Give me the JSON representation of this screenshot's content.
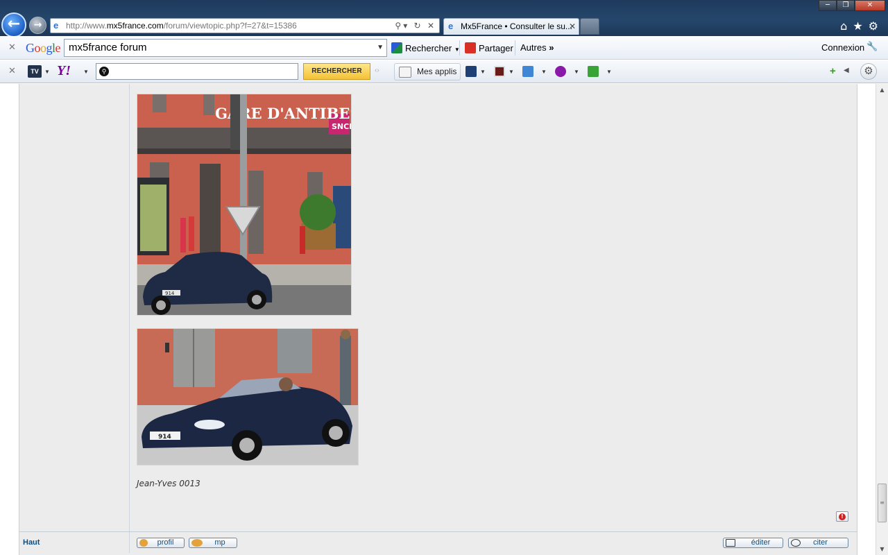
{
  "browser": {
    "url_prefix": "http://www.",
    "url_domain": "mx5france.com",
    "url_path": "/forum/viewtopic.php?f=27&t=15386",
    "tab_title": "Mx5France • Consulter le su...",
    "icons": {
      "back": "back-arrow-icon",
      "forward": "forward-arrow-icon",
      "home": "home-icon",
      "favorites": "star-icon",
      "tools": "gear-icon"
    }
  },
  "google_toolbar": {
    "logo": [
      "G",
      "o",
      "o",
      "g",
      "l",
      "e"
    ],
    "search_value": "mx5france forum",
    "search_button": "Rechercher",
    "share_button": "Partager",
    "more_button": "Autres",
    "signin": "Connexion"
  },
  "yahoo_toolbar": {
    "tv_label": "TV",
    "logo": "Y!",
    "search_value": "",
    "search_button": "RECHERCHER",
    "my_apps": "Mes applis"
  },
  "post": {
    "caption": "Jean-Yves 0013",
    "image1_sign": "GARE D'ANTIBES",
    "image1_logo": "SNCF",
    "image1_plate": "914",
    "image2_plate": "914"
  },
  "footer": {
    "top_link": "Haut",
    "profile_button": "profil",
    "pm_button": "mp",
    "edit_button": "éditer",
    "quote_button": "citer"
  },
  "colors": {
    "titlebar": "#1e3a5c",
    "post_background": "#ececec",
    "link_blue": "#0b4e83",
    "yahoo_purple": "#7b0099",
    "yahoo_button": "#f3c335"
  }
}
